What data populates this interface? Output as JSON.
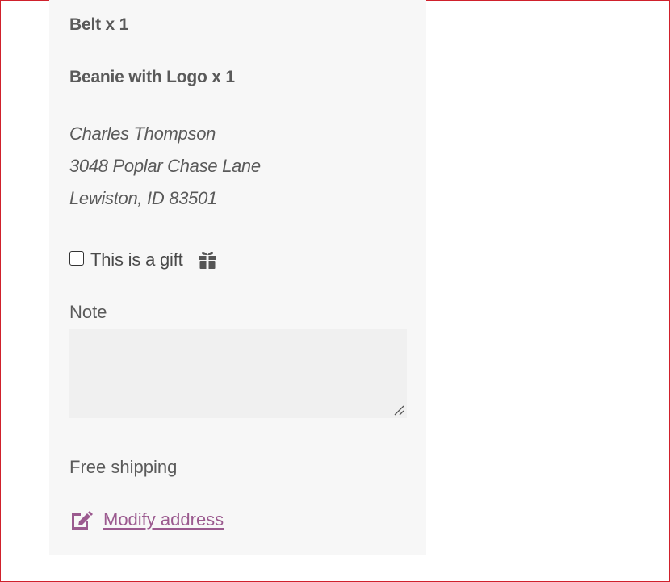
{
  "order": {
    "items": [
      {
        "label": "Belt x 1"
      },
      {
        "label": "Beanie with Logo x 1"
      }
    ],
    "address": {
      "name": "Charles Thompson",
      "street": "3048 Poplar Chase Lane",
      "city_line": "Lewiston, ID 83501"
    },
    "gift": {
      "label": "This is a gift",
      "checked": false,
      "icon": "gift-icon"
    },
    "note": {
      "label": "Note",
      "value": ""
    },
    "shipping": {
      "label": "Free shipping"
    },
    "modify": {
      "label": "Modify address",
      "icon": "edit-icon"
    }
  },
  "colors": {
    "panel_background": "#f7f7f7",
    "text": "#5a5a5a",
    "link": "#9b5a8f",
    "frame_border": "#d0212c"
  }
}
